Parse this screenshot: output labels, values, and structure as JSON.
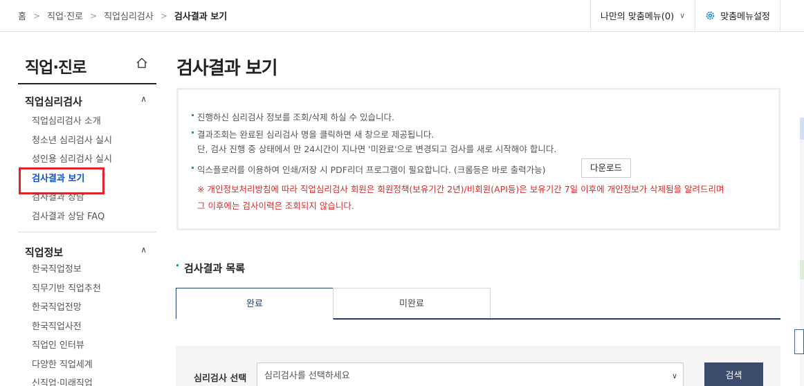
{
  "breadcrumb": {
    "home": "홈",
    "c1": "직업·진로",
    "c2": "직업심리검사",
    "current": "검사결과 보기"
  },
  "topbar": {
    "my_menu": "나만의 맞춤메뉴(0)",
    "menu_settings": "맞춤메뉴설정"
  },
  "sidebar": {
    "title": "직업·진로",
    "section1": {
      "title": "직업심리검사",
      "items": [
        "직업심리검사 소개",
        "청소년 심리검사 실시",
        "성인용 심리검사 실시",
        "검사결과 보기",
        "검사결과 상담",
        "검사결과 상담 FAQ"
      ]
    },
    "section2": {
      "title": "직업정보",
      "items": [
        "한국직업정보",
        "직무기반 직업추천",
        "한국직업전망",
        "한국직업사전",
        "직업인 인터뷰",
        "다양한 직업세계",
        "신직업·미래직업"
      ]
    }
  },
  "main": {
    "title": "검사결과 보기",
    "info": {
      "line1": "진행하신 심리검사 정보를 조회/삭제 하실 수 있습니다.",
      "line2": "결과조회는 완료된 심리검사 명을 클릭하면 새 창으로 제공됩니다.",
      "line2b": "단, 검사 진행 중 상태에서 만 24시간이 지나면 '미완료'으로 변경되고 검사를 새로 시작해야 합니다.",
      "line3": "익스플로러를 이용하여 인쇄/저장 시 PDF리더 프로그램이 필요합니다. (크롬등은 바로 출력가능)",
      "download": "다운로드",
      "warn1": "※ 개인정보처리방침에 따라 직업심리검사 회원은 회원정책(보유기간 2년)/비회원(API등)은 보유기간 7일 이후에 개인정보가 삭제됨을 알려드리며",
      "warn2": "그 이후에는 검사이력은 조회되지 않습니다."
    },
    "list_title": "검사결과 목록",
    "tabs": [
      "완료",
      "미완료"
    ],
    "search": {
      "label": "심리검사 선택",
      "select_placeholder": "심리검사를 선택하세요",
      "button": "검색"
    }
  },
  "colors": {
    "accent": "#1d3f6b",
    "highlight_border": "#e0252a",
    "warning_text": "#d62a2a",
    "active_link": "#0b51c5"
  }
}
